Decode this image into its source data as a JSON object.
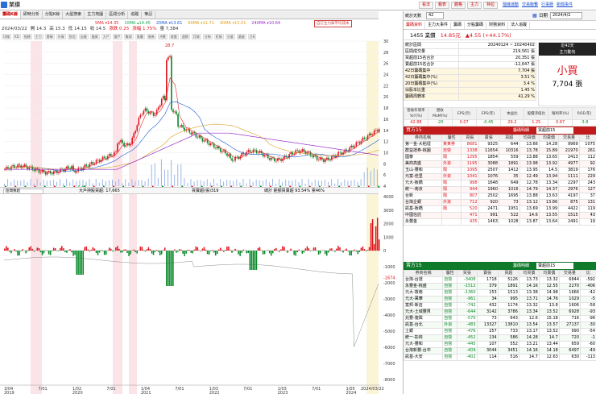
{
  "window": {
    "title": "業鑽"
  },
  "toolbar_buttons": [
    "看法",
    "報表",
    "體格",
    "主力",
    "特拉"
  ],
  "top_links": [
    "隨機運動",
    "交易聯繫",
    "行事曆",
    "新聞事件"
  ],
  "left_tabs": [
    "籌碼K線",
    "即時分析",
    "分點K線",
    "大屋搜索",
    "主力地圖",
    "區間分析",
    "追蹤",
    "筆記"
  ],
  "ma_legend": [
    {
      "label": "5MA ▾14.35",
      "color": "#e8202a"
    },
    {
      "label": "10MA ▴14.45",
      "color": "#19a64d"
    },
    {
      "label": "20MA ▾13.61",
      "color": "#1e5bd6"
    },
    {
      "label": "60MA ▾11.71",
      "color": "#d6a11e"
    },
    {
      "label": "40MA ▾13.01",
      "color": "#e8a020"
    },
    {
      "label": "240MA ▾10.64",
      "color": "#9a2cc8"
    }
  ],
  "legend_note": "自訂主力與平均成本",
  "price_info": {
    "date": "2024/03/22",
    "open": "開 14.3",
    "high": "高 15.3",
    "low": "低 14.15",
    "close": "收 14.5",
    "change": "漲跌 0.25",
    "pct": "漲幅 1.75%",
    "vol": "量 7,384"
  },
  "chart_icons": [
    "均線",
    "KD",
    "指標",
    "主力",
    "籌碼",
    "外資",
    "投信",
    "自營",
    "融資",
    "大戶",
    "散戶",
    "集保",
    "股權",
    "借券",
    "沖賣",
    "收盤",
    "週期",
    "月線",
    "分佈",
    "紅綠",
    "分量",
    "量能",
    "日K"
  ],
  "main_chart": {
    "y_ticks": [
      "30",
      "28",
      "26",
      "24",
      "22",
      "20",
      "18",
      "16",
      "14",
      "12",
      "10",
      "8",
      "6",
      "4"
    ],
    "peak_label": "28.7",
    "low_label": "4.44"
  },
  "sub_panel": {
    "select_label": "區間買超",
    "info1": "大戶持股買超: 17,665",
    "info2": "買賣超(張)319",
    "info3": "總計 鉅額買賣超 93.54% 累46%",
    "info4": "賣賣 339 賣賣 20",
    "y_ticks_upper": [
      "4000",
      "3000",
      "2000",
      "1000",
      "0"
    ],
    "y_ticks_lower": [
      "-1674",
      "-1000",
      "-2000",
      "-3000",
      "-4000",
      "-5000",
      "-6000",
      "-7000",
      "-8000"
    ]
  },
  "x_axis": {
    "labels": [
      "3/04",
      "7/01",
      "1/02",
      "7/01",
      "1/04",
      "7/01",
      "1/03",
      "7/01",
      "1/03",
      "7/01",
      "1/05",
      "2024/03/22"
    ],
    "years": [
      "2019",
      "",
      "2020",
      "",
      "2021",
      "",
      "2022",
      "",
      "2023",
      "",
      "2024",
      ""
    ]
  },
  "right_panel": {
    "date_label": "日期",
    "date_value": "2024/4/2",
    "period_label": "統計天數",
    "period_value": "42",
    "tabs": [
      "籌碼資料",
      "主力大事件",
      "籌碼",
      "分點籌碼",
      "財務資料",
      "法人追蹤"
    ],
    "stock": "1455 業鑽",
    "price": "14.85元",
    "change": "▲4.55 (+44.17%)",
    "summary": [
      {
        "k": "統計區間",
        "v": "20240124 ~ 20240402"
      },
      {
        "k": "區間成交量",
        "v": "219,561 張"
      },
      {
        "k": "買超前15名合計",
        "v": "20,351 張"
      },
      {
        "k": "賣超前15名合計",
        "v": "-12,647 張"
      },
      {
        "k": "42日籌碼集中",
        "v": "7,704 張"
      },
      {
        "k": "42日籌碼集中(%)",
        "v": "3.51 %"
      },
      {
        "k": "20日籌碼集中(%)",
        "v": "3.4 %"
      },
      {
        "k": "佔股本比重",
        "v": "1.45 %"
      },
      {
        "k": "籌碼周轉率",
        "v": "41.29 %"
      }
    ],
    "summary_right": {
      "title": "近42天",
      "sub": "主力動向",
      "verdict": "小買",
      "amount": "7,704 張"
    },
    "fin_headers": [
      "營收年增率YoY(%)",
      "營收MoM(%)",
      "EPS(元)",
      "EPS(年)",
      "本益比",
      "股價淨值比",
      "殖利率(%)",
      "ROE(年)"
    ],
    "fin_values": [
      "42.88",
      "-20",
      "0.07",
      "-0.45",
      "29.2",
      "1.25",
      "0.67",
      "-3.8"
    ],
    "buy_panel": {
      "title": "買方15",
      "filter": "買超前15",
      "subtitle": "籌碼明細"
    },
    "sell_panel": {
      "title": "賣方15",
      "filter": "賣超前15",
      "subtitle": "籌碼明細"
    },
    "col_headers": [
      "券商名稱",
      "屬性",
      "買張",
      "賣張",
      "買超",
      "均買價",
      "均賣價",
      "交易量",
      "比"
    ],
    "buy_rows": [
      [
        "第一金-大稻埕",
        "某某券",
        "8681",
        "9325",
        "644",
        "13.66",
        "14.28",
        "9969",
        "1075"
      ],
      [
        "群益證券-桃園",
        "自營",
        "1338",
        "11654",
        "10316",
        "13.78",
        "15.89",
        "21970",
        "261"
      ],
      [
        "國泰",
        "隔",
        "1295",
        "1854",
        "559",
        "13.88",
        "13.65",
        "2413",
        "112"
      ],
      [
        "美商高盛",
        "外資",
        "1195",
        "3088",
        "1891",
        "13.98",
        "13.92",
        "4977",
        "92"
      ],
      [
        "玉山-豐和",
        "隔",
        "1095",
        "2507",
        "1412",
        "13.95",
        "14.5",
        "3819",
        "176"
      ],
      [
        "元富-佳里",
        "外資",
        "1041",
        "1076",
        "35",
        "12.49",
        "13.94",
        "1111",
        "229"
      ],
      [
        "元大-板橋",
        "隔",
        "998",
        "1648",
        "649",
        "12.78",
        "13.34",
        "2297",
        "243"
      ],
      [
        "統一-南京",
        "隔",
        "944",
        "1960",
        "1016",
        "14.79",
        "14.37",
        "2976",
        "127"
      ],
      [
        "台新",
        "隔",
        "807",
        "2502",
        "1695",
        "13.88",
        "13.63",
        "4197",
        "37"
      ],
      [
        "台灣企銀",
        "外資",
        "712",
        "920",
        "73",
        "13.12",
        "13.86",
        "875",
        "131"
      ],
      [
        "凱基-板橋",
        "隔",
        "520",
        "2471",
        "1951",
        "13.69",
        "13.99",
        "4422",
        "119"
      ],
      [
        "中國信託",
        "",
        "471",
        "991",
        "522",
        "14.6",
        "13.55",
        "1515",
        "43"
      ],
      [
        "永豐金",
        "",
        "435",
        "1463",
        "1028",
        "13.87",
        "13.64",
        "2491",
        "19"
      ]
    ],
    "sell_rows": [
      [
        "台灣-台證",
        "自營",
        "-3408",
        "1718",
        "5126",
        "13.73",
        "13.32",
        "6844",
        "-592"
      ],
      [
        "永豐金-桃盛",
        "自營",
        "-1512",
        "379",
        "1891",
        "14.16",
        "12.55",
        "2270",
        "-406"
      ],
      [
        "元大-敦南",
        "自營",
        "-1360",
        "153",
        "1513",
        "13.38",
        "14.98",
        "1666",
        "-42"
      ],
      [
        "元大-萬華",
        "自營",
        "-961",
        "34",
        "995",
        "13.71",
        "14.76",
        "1029",
        "-5"
      ],
      [
        "富邦-新店",
        "自營",
        "-742",
        "432",
        "1174",
        "13.32",
        "13.8",
        "1606",
        "-58"
      ],
      [
        "元大-土城豐貝",
        "自營",
        "-644",
        "3142",
        "3786",
        "13.34",
        "13.52",
        "6928",
        "-93"
      ],
      [
        "兆豐-復興",
        "自營",
        "-570",
        "73",
        "643",
        "12.6",
        "15.18",
        "716",
        "-96"
      ],
      [
        "凱基-台北",
        "外資",
        "-483",
        "13327",
        "13810",
        "13.54",
        "13.57",
        "27137",
        "-30"
      ],
      [
        "土銀",
        "自營",
        "-476",
        "257",
        "733",
        "13.17",
        "13.52",
        "990",
        "-54"
      ],
      [
        "統一-彰商",
        "自營",
        "-452",
        "134",
        "586",
        "14.28",
        "14.7",
        "720",
        "-1"
      ],
      [
        "元大-豐和",
        "自營",
        "-445",
        "107",
        "552",
        "13.21",
        "13.44",
        "659",
        "-60"
      ],
      [
        "台灣新豐-台中",
        "自營",
        "-409",
        "3044",
        "3451",
        "14.16",
        "14.18",
        "6497",
        "-49"
      ],
      [
        "凱基-大安",
        "自營",
        "-402",
        "114",
        "516",
        "14.7",
        "12.63",
        "630",
        "-113"
      ]
    ]
  }
}
